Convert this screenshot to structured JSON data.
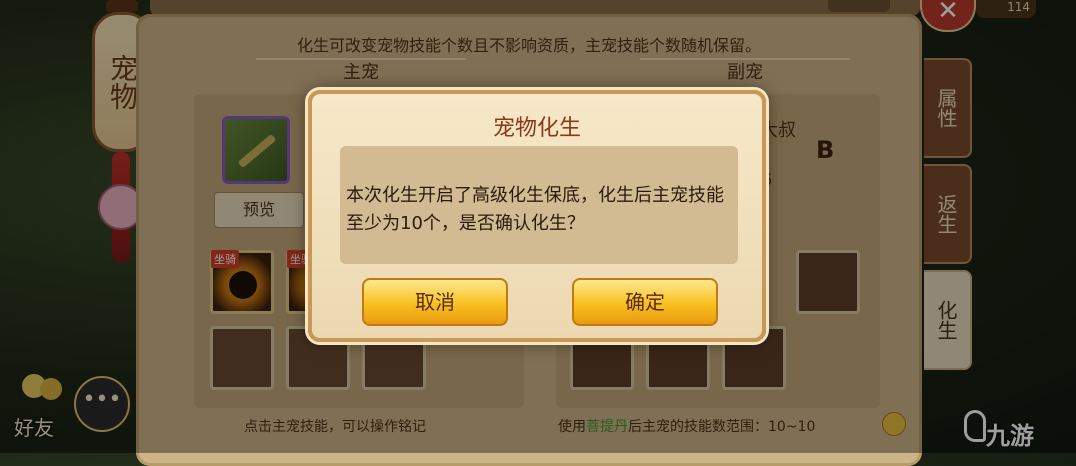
{
  "top_hint": "化生可改变宠物技能个数且不影响资质，主宠技能个数随机保留。",
  "main_pet": {
    "header": "主宠",
    "preview_button": "预览",
    "skill_tag": "坐骑"
  },
  "sub_pet": {
    "header": "副宠",
    "name_fragment": "大叔",
    "grade": "B",
    "number_fragment": "6"
  },
  "bottom_left_hint": "点击主宠技能，可以操作铭记",
  "bottom_right_hint": {
    "prefix": "使用",
    "item": "菩提丹",
    "suffix": "后主宠的技能数范围：10~10"
  },
  "side_title": "宠物",
  "tabs": [
    {
      "label": "属性",
      "active": false
    },
    {
      "label": "返生",
      "active": false
    },
    {
      "label": "化生",
      "active": true
    }
  ],
  "top_right_value": "114",
  "friends_label": "好友",
  "chat_icon": "•••",
  "watermark": "九游",
  "modal": {
    "title": "宠物化生",
    "message": "本次化生开启了高级化生保底，化生后主宠技能至少为10个，是否确认化生？",
    "cancel_label": "取消",
    "confirm_label": "确定"
  },
  "colors": {
    "accent_gold": "#f8c020",
    "title_red": "#8a3a18",
    "item_green": "#3a9a2a"
  }
}
